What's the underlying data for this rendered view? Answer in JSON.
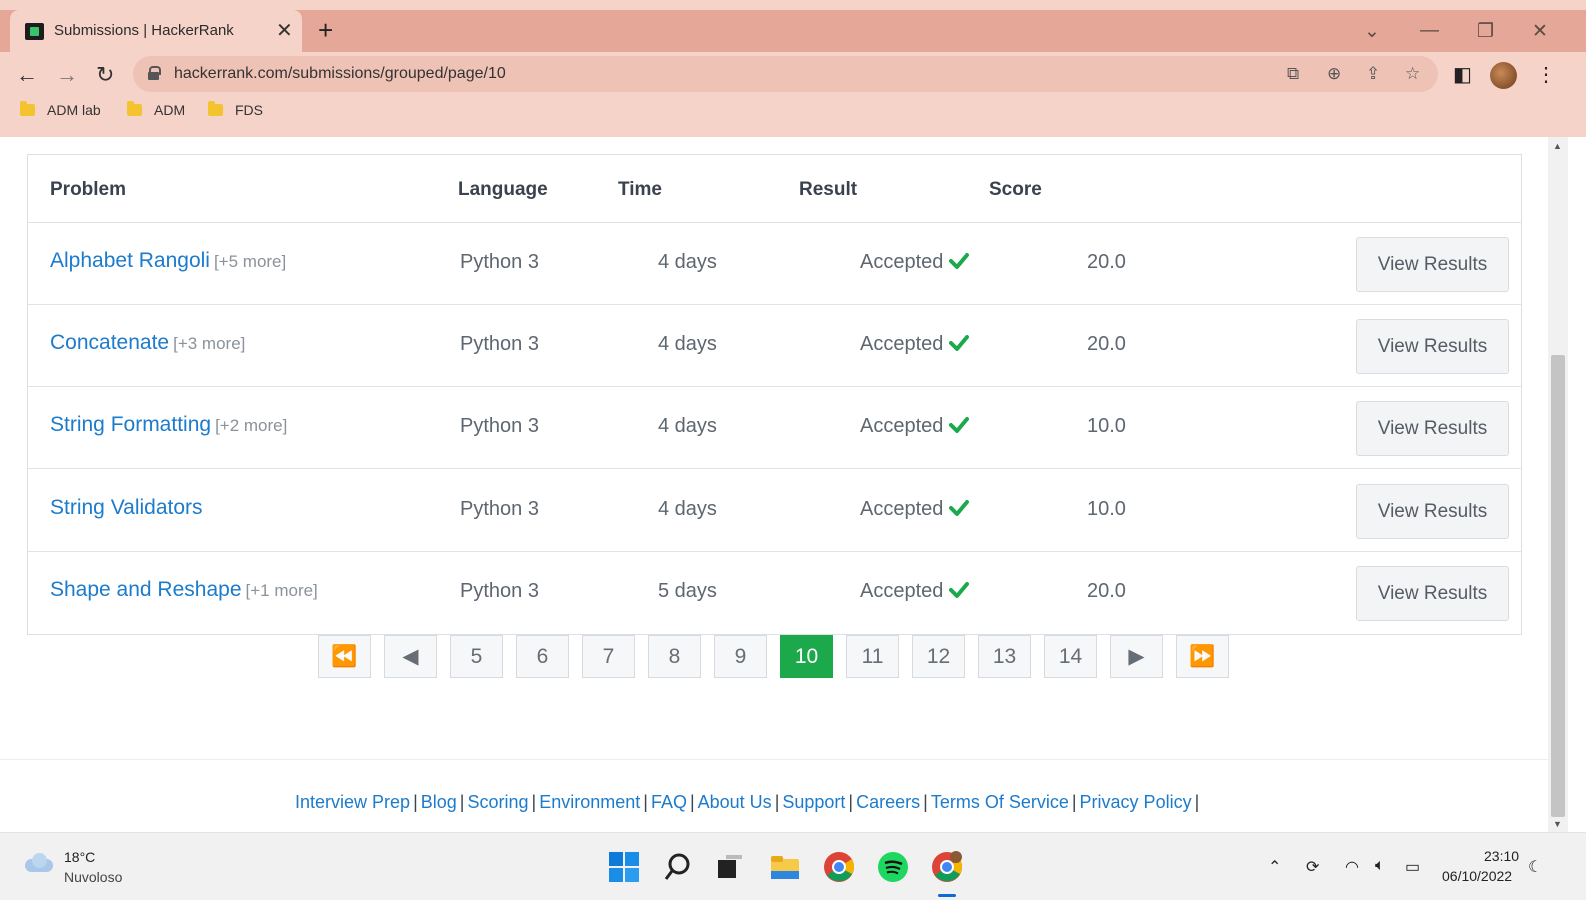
{
  "browser": {
    "tab_title": "Submissions | HackerRank",
    "url": "hackerrank.com/submissions/grouped/page/10",
    "bookmarks": [
      "ADM lab",
      "ADM",
      "FDS"
    ]
  },
  "table": {
    "headers": {
      "problem": "Problem",
      "language": "Language",
      "time": "Time",
      "result": "Result",
      "score": "Score"
    },
    "rows": [
      {
        "problem": "Alphabet Rangoli",
        "more": "[+5 more]",
        "language": "Python 3",
        "time": "4 days",
        "result": "Accepted",
        "score": "20.0",
        "action": "View Results"
      },
      {
        "problem": "Concatenate",
        "more": "[+3 more]",
        "language": "Python 3",
        "time": "4 days",
        "result": "Accepted",
        "score": "20.0",
        "action": "View Results"
      },
      {
        "problem": "String Formatting",
        "more": "[+2 more]",
        "language": "Python 3",
        "time": "4 days",
        "result": "Accepted",
        "score": "10.0",
        "action": "View Results"
      },
      {
        "problem": "String Validators",
        "more": "",
        "language": "Python 3",
        "time": "4 days",
        "result": "Accepted",
        "score": "10.0",
        "action": "View Results"
      },
      {
        "problem": "Shape and Reshape",
        "more": "[+1 more]",
        "language": "Python 3",
        "time": "5 days",
        "result": "Accepted",
        "score": "20.0",
        "action": "View Results"
      }
    ]
  },
  "pagination": {
    "first": "⏪",
    "prev": "◀",
    "pages": [
      "5",
      "6",
      "7",
      "8",
      "9",
      "10",
      "11",
      "12",
      "13",
      "14"
    ],
    "current": "10",
    "next": "▶",
    "last": "⏩"
  },
  "footer": {
    "links": [
      "Interview Prep",
      "Blog",
      "Scoring",
      "Environment",
      "FAQ",
      "About Us",
      "Support",
      "Careers",
      "Terms Of Service",
      "Privacy Policy"
    ]
  },
  "taskbar": {
    "temperature": "18°C",
    "condition": "Nuvoloso",
    "time": "23:10",
    "date": "06/10/2022"
  },
  "colors": {
    "accent_green": "#1ba94c",
    "link_blue": "#1c7bcc",
    "chrome_bg": "#f6d3c8",
    "tabstrip_bg": "#e5a797"
  }
}
